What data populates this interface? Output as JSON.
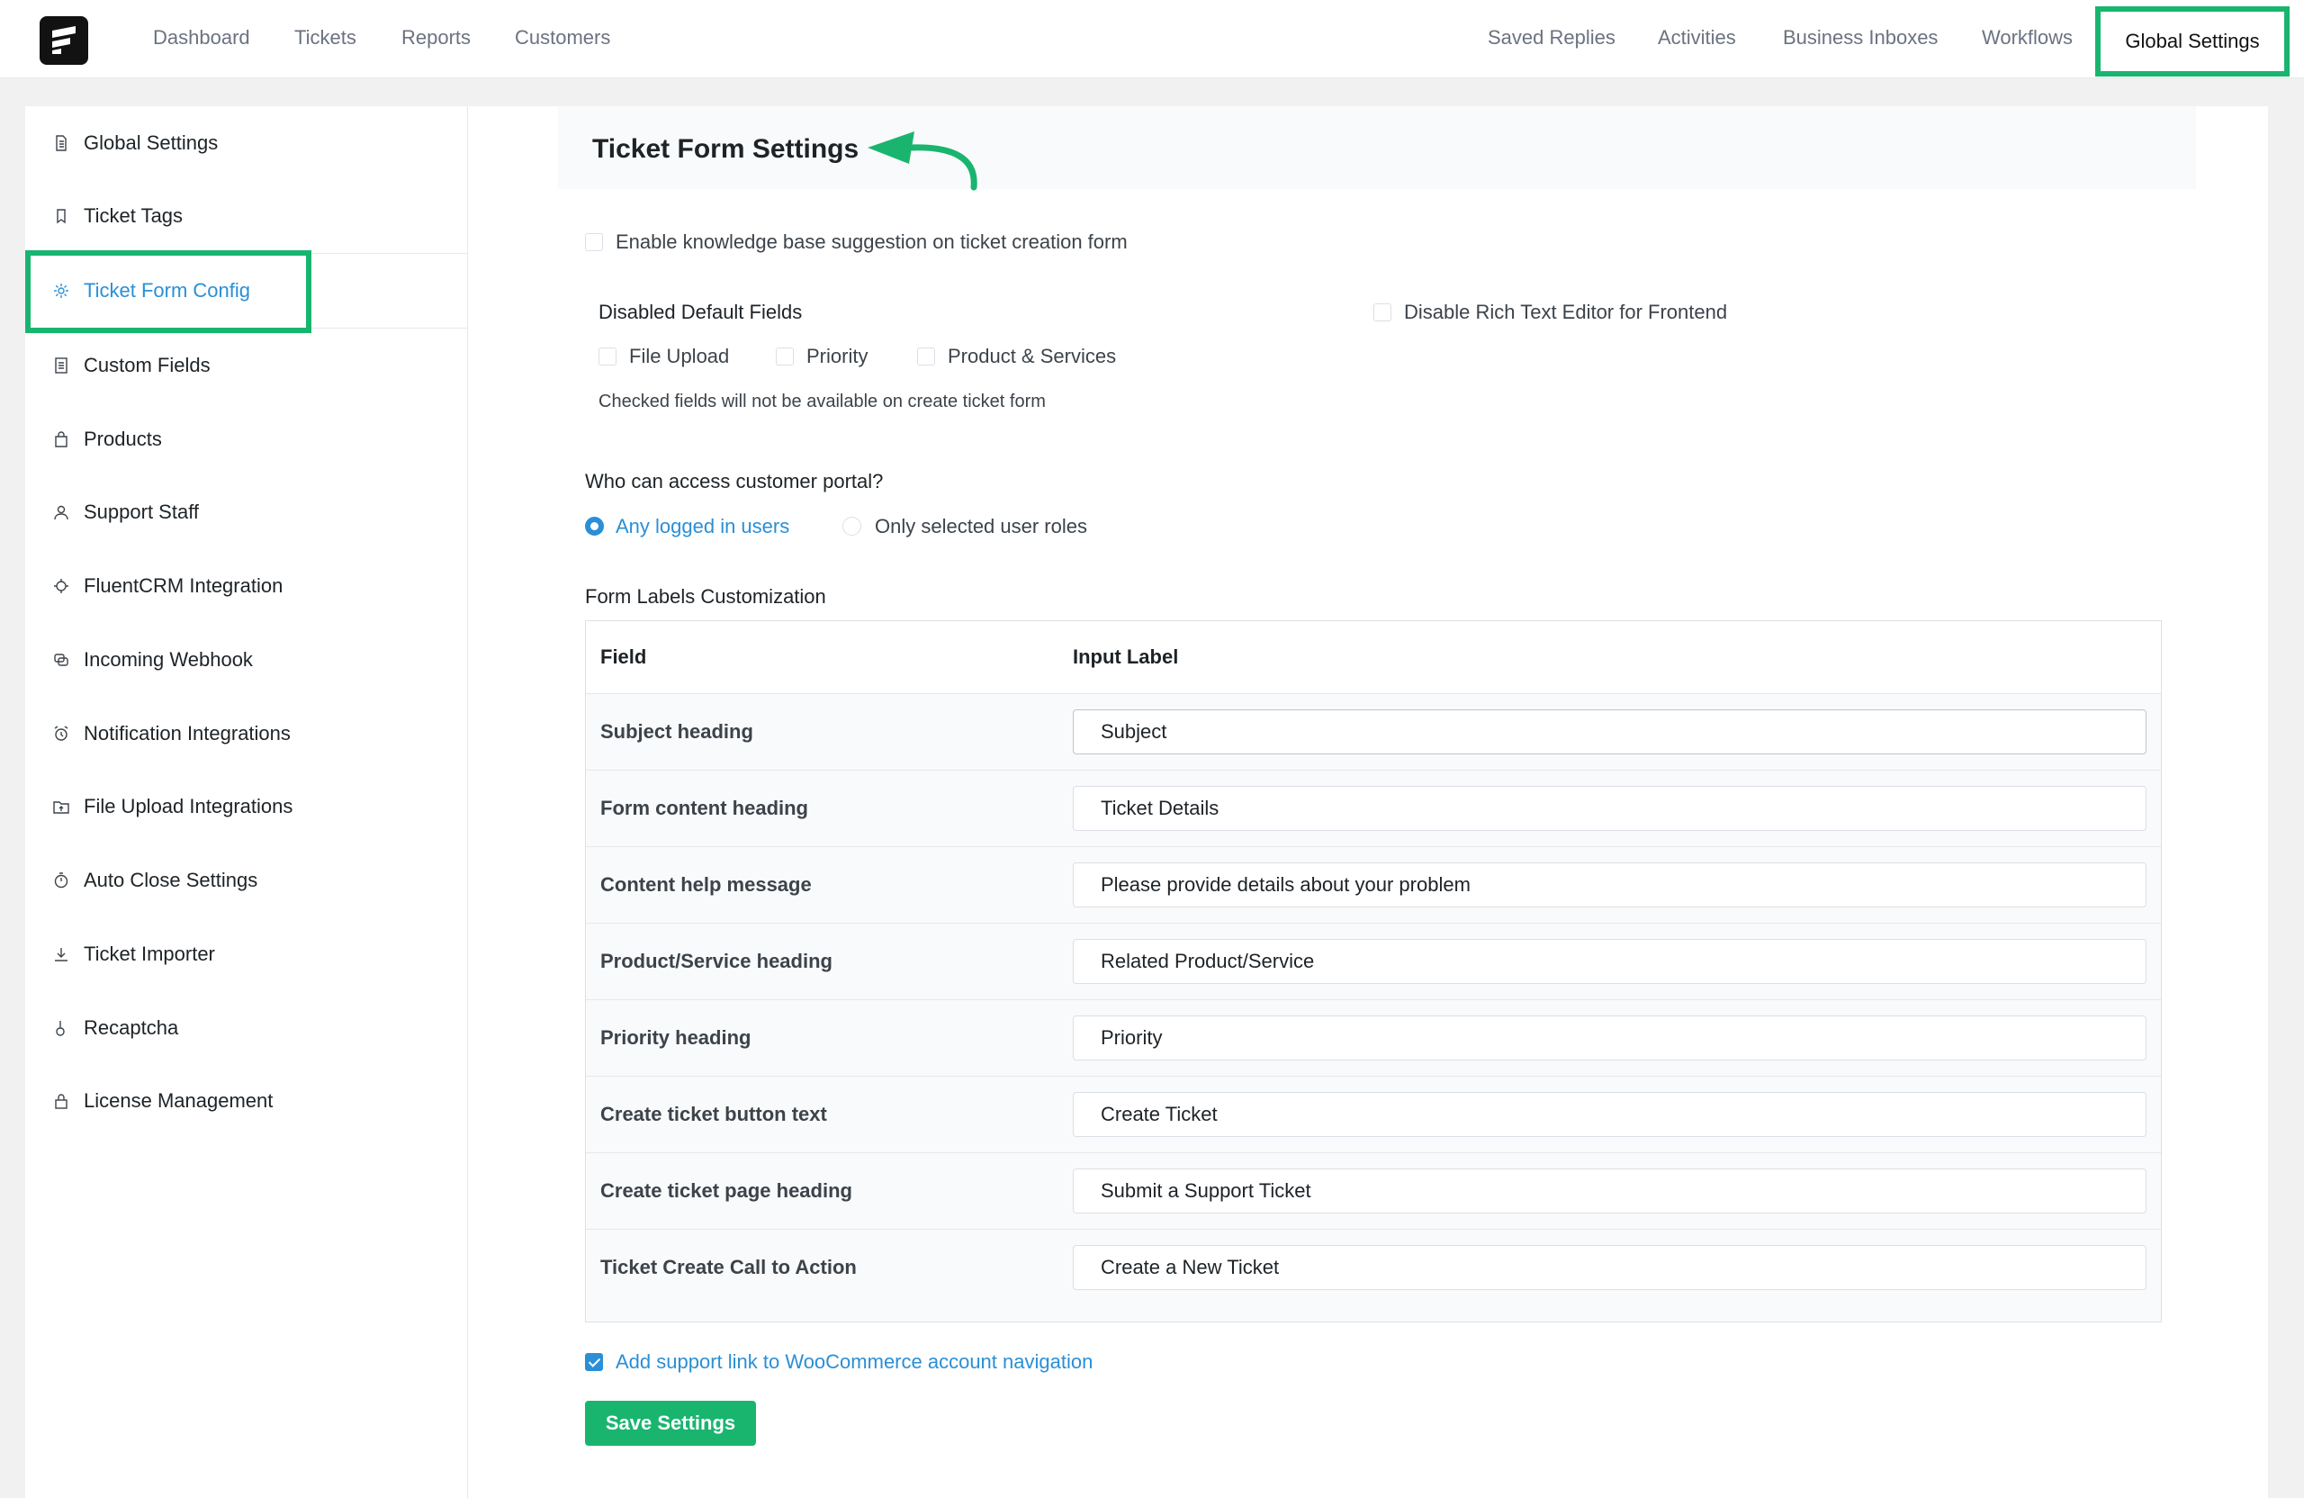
{
  "topnav": {
    "left": [
      "Dashboard",
      "Tickets",
      "Reports",
      "Customers"
    ],
    "right": [
      "Saved Replies",
      "Activities",
      "Business Inboxes",
      "Workflows"
    ],
    "active": "Global Settings"
  },
  "sidebar": {
    "items": [
      {
        "label": "Global Settings",
        "icon": "document-icon"
      },
      {
        "label": "Ticket Tags",
        "icon": "bookmark-icon"
      },
      {
        "label": "Ticket Form Config",
        "icon": "gear-icon"
      },
      {
        "label": "Custom Fields",
        "icon": "list-icon"
      },
      {
        "label": "Products",
        "icon": "bag-icon"
      },
      {
        "label": "Support Staff",
        "icon": "user-icon"
      },
      {
        "label": "FluentCRM Integration",
        "icon": "cog-icon"
      },
      {
        "label": "Incoming Webhook",
        "icon": "webhook-icon"
      },
      {
        "label": "Notification Integrations",
        "icon": "alarm-icon"
      },
      {
        "label": "File Upload Integrations",
        "icon": "folder-upload-icon"
      },
      {
        "label": "Auto Close Settings",
        "icon": "timer-icon"
      },
      {
        "label": "Ticket Importer",
        "icon": "download-icon"
      },
      {
        "label": "Recaptcha",
        "icon": "hand-icon"
      },
      {
        "label": "License Management",
        "icon": "lock-icon"
      }
    ],
    "active_index": 2
  },
  "main": {
    "title": "Ticket Form Settings",
    "kb_suggestion": {
      "label": "Enable knowledge base suggestion on ticket creation form",
      "checked": false
    },
    "disabled_fields": {
      "heading": "Disabled Default Fields",
      "options": [
        {
          "label": "File Upload",
          "checked": false
        },
        {
          "label": "Priority",
          "checked": false
        },
        {
          "label": "Product & Services",
          "checked": false
        }
      ],
      "help": "Checked fields will not be available on create ticket form"
    },
    "rich_text": {
      "label": "Disable Rich Text Editor for Frontend",
      "checked": false
    },
    "portal_access": {
      "question": "Who can access customer portal?",
      "options": [
        {
          "label": "Any logged in users",
          "checked": true
        },
        {
          "label": "Only selected user roles",
          "checked": false
        }
      ]
    },
    "labels_customization": {
      "heading": "Form Labels Customization",
      "col_field": "Field",
      "col_input": "Input Label",
      "rows": [
        {
          "field": "Subject heading",
          "value": "Subject"
        },
        {
          "field": "Form content heading",
          "value": "Ticket Details"
        },
        {
          "field": "Content help message",
          "value": "Please provide details about your problem"
        },
        {
          "field": "Product/Service heading",
          "value": "Related Product/Service"
        },
        {
          "field": "Priority heading",
          "value": "Priority"
        },
        {
          "field": "Create ticket button text",
          "value": "Create Ticket"
        },
        {
          "field": "Create ticket page heading",
          "value": "Submit a Support Ticket"
        },
        {
          "field": "Ticket Create Call to Action",
          "value": "Create a New Ticket"
        }
      ]
    },
    "woo_link": {
      "label": "Add support link to WooCommerce account navigation",
      "checked": true
    },
    "save_label": "Save Settings"
  },
  "colors": {
    "accent": "#19b56f",
    "link": "#2a8fd6"
  }
}
